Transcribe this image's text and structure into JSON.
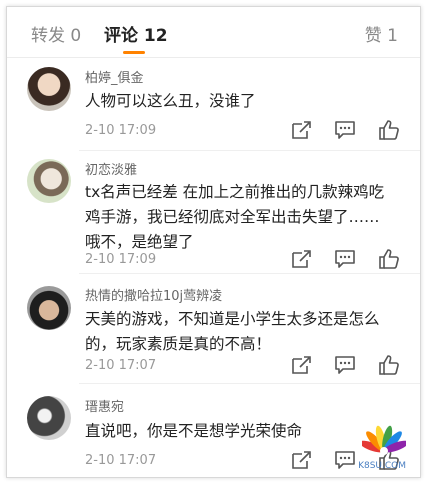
{
  "tabs": {
    "repost": "转发 0",
    "comments": "评论 12",
    "likes": "赞 1"
  },
  "comments": [
    {
      "user": "柏婷_俱金",
      "text": "人物可以这么丑，没谁了",
      "time": "2-10 17:09"
    },
    {
      "user": "初恋淡雅",
      "text": "tx名声已经差 在加上之前推出的几款辣鸡吃鸡手游，我已经彻底对全军出击失望了……哦不，是绝望了",
      "time": "2-10 17:09"
    },
    {
      "user": "热情的撒哈拉10j莺辨凌",
      "text": "天美的游戏，不知道是小学生太多还是怎么的，玩家素质是真的不高！",
      "time": "2-10 17:07"
    },
    {
      "user": "瑨惠宛",
      "text": "直说吧，你是不是想学光荣使命",
      "time": "2-10 17:07"
    }
  ],
  "icons": {
    "repost": "share-icon",
    "comment": "comment-icon",
    "like": "thumbs-up-icon"
  },
  "watermark": "K8SU.COM",
  "colors": {
    "accent": "#ff8200",
    "text": "#222222",
    "muted": "#999999"
  }
}
